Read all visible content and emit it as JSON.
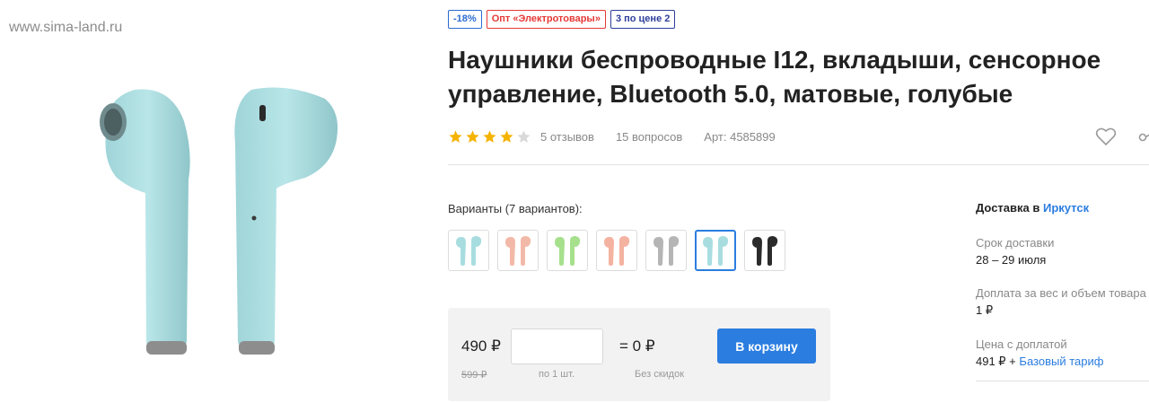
{
  "watermark": "www.sima-land.ru",
  "badges": {
    "discount": "-18%",
    "opt": "Опт «Электротовары»",
    "promo": "3 по цене 2"
  },
  "product": {
    "title": "Наушники беспроводные I12, вкладыши, сенсорное управление, Bluetooth 5.0, матовые, голубые",
    "rating": 4,
    "rating_max": 5,
    "reviews": "5 отзывов",
    "questions": "15 вопросов",
    "article": "Арт: 4585899",
    "image_color": "#a8dde0"
  },
  "variants": {
    "label": "Варианты (7 вариантов):",
    "colors": [
      "#a8dde0",
      "#f2b9a8",
      "#a6e08d",
      "#f4b3a0",
      "#b5b5b5",
      "#a8dde0",
      "#2b2b2b"
    ],
    "selected_index": 5
  },
  "purchase": {
    "price": "490 ₽",
    "old_price": "599 ₽",
    "qty_value": "",
    "qty_note": "по 1 шт.",
    "total": "= 0 ₽",
    "total_note": "Без скидок",
    "cart_button": "В корзину"
  },
  "delivery": {
    "title_prefix": "Доставка в",
    "city": "Иркутск",
    "term_label": "Срок доставки",
    "term_value": "28 – 29 июля",
    "surcharge_label": "Доплата за вес и объем товара",
    "surcharge_value": "1 ₽",
    "price_label": "Цена с доплатой",
    "price_value": "491 ₽ +",
    "tariff_link": "Базовый тариф"
  },
  "colors": {
    "accent": "#2b7de0",
    "star_active": "#f5b301",
    "star_inactive": "#d9d9d9"
  }
}
